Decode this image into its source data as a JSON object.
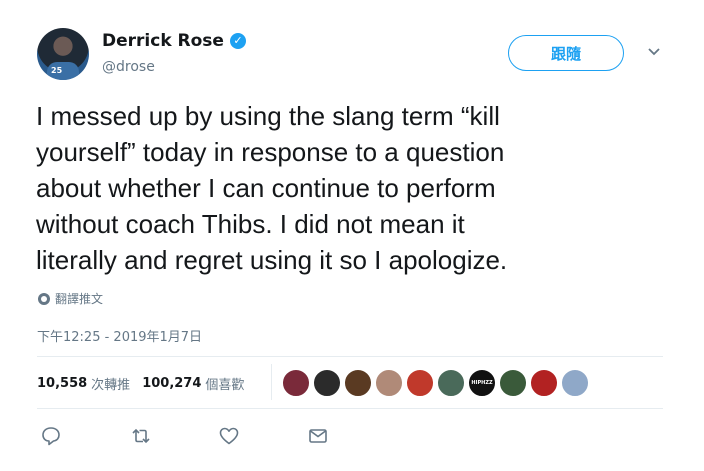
{
  "user": {
    "name": "Derrick Rose",
    "handle": "@drose",
    "avatar_jersey_number": "25"
  },
  "follow_button_label": "跟隨",
  "tweet": {
    "text": "I messed up by using the slang term “kill\nyourself” today in response to a question\nabout whether I can continue to perform\nwithout coach Thibs.  I did not mean it\nliterally and regret using it so I apologize."
  },
  "translate_label": "翻譯推文",
  "timestamp": "下午12:25 - 2019年1月7日",
  "stats": {
    "retweets_count": "10,558",
    "retweets_label": "次轉推",
    "likes_count": "100,274",
    "likes_label": "個喜歡"
  },
  "likers": [
    {
      "color": "#7a2a3a"
    },
    {
      "color": "#2b2b2b"
    },
    {
      "color": "#5a3a22"
    },
    {
      "color": "#b08a78"
    },
    {
      "color": "#c0392b"
    },
    {
      "color": "#4a6a5a"
    },
    {
      "color": "#111111",
      "text": "HIPHZZ"
    },
    {
      "color": "#3a5a3a"
    },
    {
      "color": "#b22222"
    },
    {
      "color": "#8fa8c8"
    }
  ],
  "colors": {
    "accent": "#1da1f2",
    "text_primary": "#14171a",
    "text_secondary": "#657786",
    "divider": "#e6ecf0"
  },
  "icons": [
    "verified-badge-icon",
    "chevron-down-icon",
    "globe-icon",
    "reply-icon",
    "retweet-icon",
    "like-icon",
    "direct-message-icon"
  ]
}
